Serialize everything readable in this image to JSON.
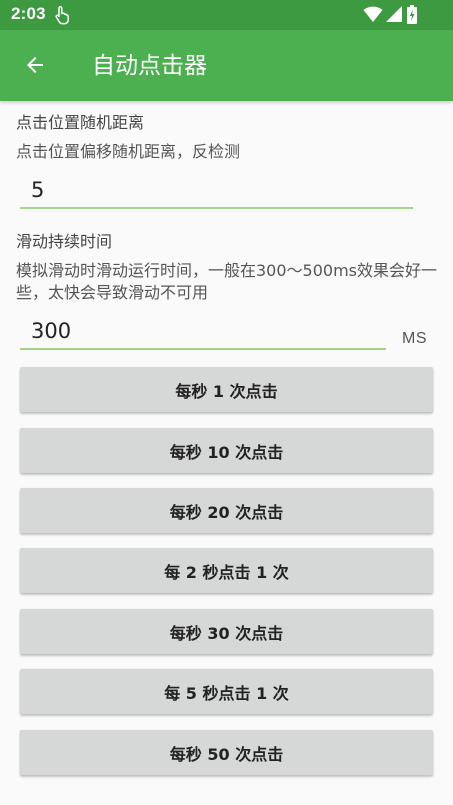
{
  "status_bar": {
    "time": "2:03",
    "icons": [
      "touch-icon",
      "wifi-icon",
      "signal-icon",
      "battery-icon"
    ]
  },
  "app_bar": {
    "title": "自动点击器",
    "back_icon": "arrow-back-icon",
    "color": "#4caf50"
  },
  "settings": {
    "random_distance": {
      "title": "点击位置随机距离",
      "description": "点击位置偏移随机距离，反检测",
      "value": "5"
    },
    "swipe_duration": {
      "title": "滑动持续时间",
      "description": "模拟滑动时滑动运行时间，一般在300～500ms效果会好一些，太快会导致滑动不可用",
      "value": "300",
      "unit": "MS"
    }
  },
  "buttons": [
    {
      "label": "每秒 1 次点击"
    },
    {
      "label": "每秒 10 次点击"
    },
    {
      "label": "每秒 20 次点击"
    },
    {
      "label": "每 2 秒点击 1 次"
    },
    {
      "label": "每秒 30 次点击"
    },
    {
      "label": "每 5 秒点击 1 次"
    },
    {
      "label": "每秒 50 次点击"
    }
  ]
}
